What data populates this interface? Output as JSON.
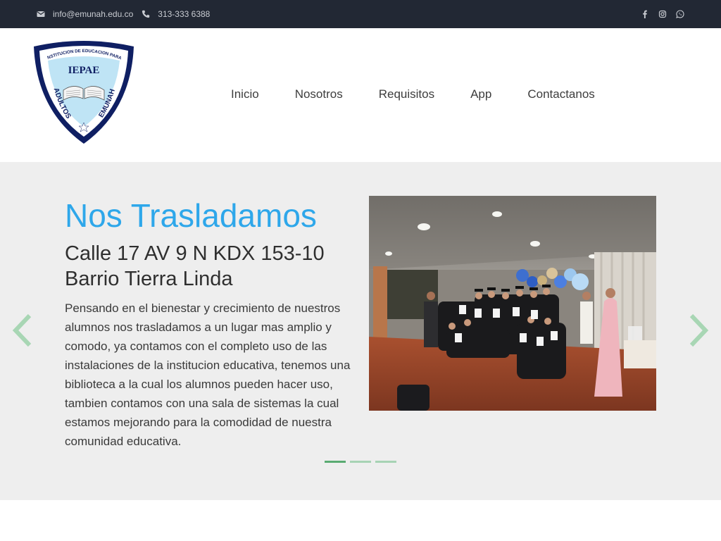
{
  "topbar": {
    "email": "info@emunah.edu.co",
    "phone": "313-333 6388",
    "social": [
      "facebook-icon",
      "instagram-icon",
      "whatsapp-icon"
    ]
  },
  "logo": {
    "acronym": "IEPAE",
    "arc_text": "INSTITUCION DE EDUCACION PARA",
    "left_text": "ADULTOS",
    "right_text": "EMUNAH"
  },
  "nav": {
    "items": [
      {
        "label": "Inicio"
      },
      {
        "label": "Nosotros"
      },
      {
        "label": "Requisitos"
      },
      {
        "label": "App"
      },
      {
        "label": "Contactanos"
      }
    ]
  },
  "slide": {
    "title": "Nos Trasladamos",
    "subtitle": "Calle 17 AV 9 N KDX 153-10 Barrio Tierra Linda",
    "body": "Pensando en el bienestar y crecimiento de nuestros alumnos nos trasladamos a un lugar mas amplio y comodo, ya contamos con el completo uso de las instalaciones de la institucion educativa, tenemos una biblioteca a la cual los alumnos pueden hacer uso, tambien contamos con una sala de sistemas la cual estamos mejorando para la comodidad de nuestra comunidad educativa.",
    "dots": 3,
    "active_dot": 1
  },
  "colors": {
    "topbar_bg": "#222834",
    "title_blue": "#2ea7ea",
    "hero_bg": "#eeeeee",
    "arrow_green": "#a8d6b4",
    "dot_active": "#5aab72"
  }
}
